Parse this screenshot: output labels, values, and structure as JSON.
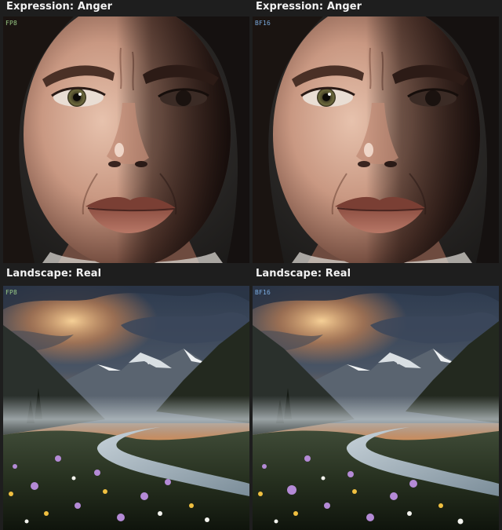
{
  "panels": [
    {
      "label": "Expression: Anger",
      "badge": "FP8",
      "badge_color": "#9fd28a",
      "scene": "portrait-angry-woman",
      "description_icon": "portrait-image"
    },
    {
      "label": "Expression: Anger",
      "badge": "BF16",
      "badge_color": "#7fb2e8",
      "scene": "portrait-angry-woman",
      "description_icon": "portrait-image"
    },
    {
      "label": "Landscape: Real",
      "badge": "FP8",
      "badge_color": "#9fd28a",
      "scene": "mountain-valley-landscape",
      "description_icon": "landscape-image"
    },
    {
      "label": "Landscape: Real",
      "badge": "BF16",
      "badge_color": "#7fb2e8",
      "scene": "mountain-valley-landscape",
      "description_icon": "landscape-image"
    }
  ],
  "colors": {
    "background": "#1e1e1e",
    "label_text": "#f2f2f2"
  }
}
